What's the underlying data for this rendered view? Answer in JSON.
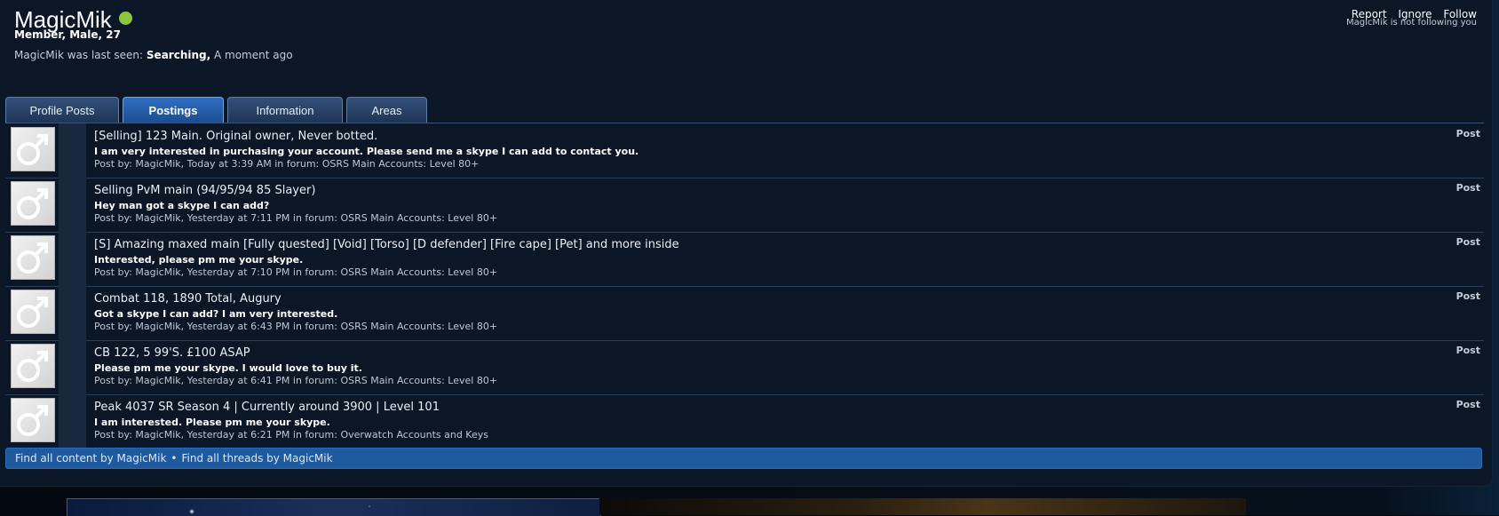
{
  "profile": {
    "username": "MagicMik",
    "meta": "Member, Male, 27",
    "last_seen_prefix": "MagicMik was last seen:",
    "last_seen_activity": "Searching,",
    "last_seen_time": "A moment ago",
    "online_color": "#8cc63f"
  },
  "actions": {
    "report": "Report",
    "ignore": "Ignore",
    "follow": "Follow",
    "follow_status": "MagicMik is not following you"
  },
  "tabs": [
    {
      "label": "Profile Posts",
      "active": false
    },
    {
      "label": "Postings",
      "active": true
    },
    {
      "label": "Information",
      "active": false
    },
    {
      "label": "Areas",
      "active": false
    }
  ],
  "postings": [
    {
      "title": "[Selling] 123 Main. Original owner, Never botted.",
      "snippet": "I am very interested in purchasing your account. Please send me a skype I can add to contact you.",
      "meta": "Post by: MagicMik, Today at 3:39 AM in forum: OSRS Main Accounts: Level 80+",
      "type": "Post"
    },
    {
      "title": "Selling PvM main (94/95/94 85 Slayer)",
      "snippet": "Hey man got a skype I can add?",
      "meta": "Post by: MagicMik, Yesterday at 7:11 PM in forum: OSRS Main Accounts: Level 80+",
      "type": "Post"
    },
    {
      "title": "[S] Amazing maxed main [Fully quested] [Void] [Torso] [D defender] [Fire cape] [Pet] and more inside",
      "snippet": "Interested, please pm me your skype.",
      "meta": "Post by: MagicMik, Yesterday at 7:10 PM in forum: OSRS Main Accounts: Level 80+",
      "type": "Post"
    },
    {
      "title": "Combat 118, 1890 Total, Augury",
      "snippet": "Got a skype I can add? I am very interested.",
      "meta": "Post by: MagicMik, Yesterday at 6:43 PM in forum: OSRS Main Accounts: Level 80+",
      "type": "Post"
    },
    {
      "title": "CB 122, 5 99'S. £100 ASAP",
      "snippet": "Please pm me your skype. I would love to buy it.",
      "meta": "Post by: MagicMik, Yesterday at 6:41 PM in forum: OSRS Main Accounts: Level 80+",
      "type": "Post"
    },
    {
      "title": "Peak 4037 SR Season 4 | Currently around 3900 | Level 101",
      "snippet": "I am interested. Please pm me your skype.",
      "meta": "Post by: MagicMik, Yesterday at 6:21 PM in forum: Overwatch Accounts and Keys",
      "type": "Post"
    }
  ],
  "footer": {
    "find_content": "Find all content by MagicMik",
    "separator": "•",
    "find_threads": "Find all threads by MagicMik"
  }
}
